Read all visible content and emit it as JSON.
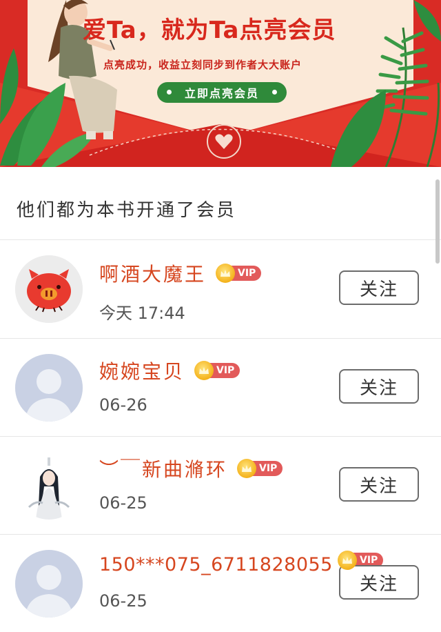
{
  "banner": {
    "title": "爱Ta，就为Ta点亮会员",
    "subtitle": "点亮成功，收益立刻同步到作者大大账户",
    "cta_label": "立即点亮会员"
  },
  "section": {
    "title": "他们都为本书开通了会员"
  },
  "vip_badge_text": "VIP",
  "colors": {
    "banner_red": "#e0352c",
    "name_red": "#d6461f",
    "cta_green": "#2f8a3a",
    "vip_tag": "#e25a5a"
  },
  "members": [
    {
      "name": "啊酒大魔王",
      "time": "今天 17:44",
      "follow_label": "关注",
      "avatar": "pig-avatar"
    },
    {
      "name": "婉婉宝贝",
      "time": "06-26",
      "follow_label": "关注",
      "avatar": "default-avatar"
    },
    {
      "name": "︶￣新曲滫环",
      "time": "06-25",
      "follow_label": "关注",
      "avatar": "character-avatar"
    },
    {
      "name": "150***075_6711828055",
      "time": "06-25",
      "follow_label": "关注",
      "avatar": "default-avatar"
    }
  ]
}
